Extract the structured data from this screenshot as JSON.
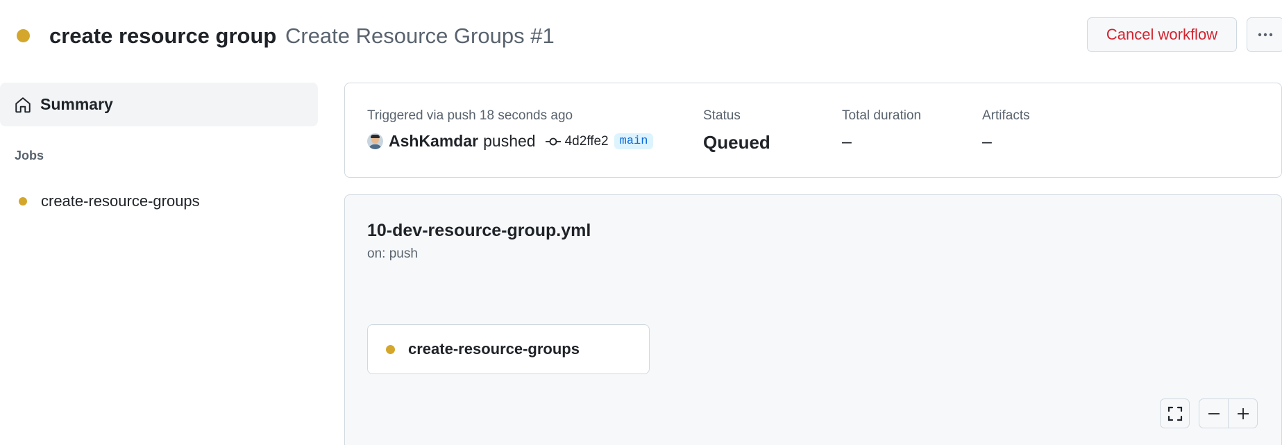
{
  "header": {
    "status_color": "#d4a72c",
    "workflow_name": "create resource group",
    "run_title": "Create Resource Groups #1",
    "cancel_label": "Cancel workflow",
    "more_label": "···"
  },
  "sidebar": {
    "summary_label": "Summary",
    "summary_icon": "home-icon",
    "jobs_heading": "Jobs",
    "jobs": [
      {
        "label": "create-resource-groups",
        "status": "queued"
      }
    ]
  },
  "info": {
    "trigger_label": "Triggered via push 18 seconds ago",
    "actor": "AshKamdar",
    "action": "pushed",
    "commit_sha": "4d2ffe2",
    "branch": "main",
    "status_label": "Status",
    "status_value": "Queued",
    "duration_label": "Total duration",
    "duration_value": "–",
    "artifacts_label": "Artifacts",
    "artifacts_value": "–"
  },
  "graph": {
    "file_name": "10-dev-resource-group.yml",
    "trigger": "on: push",
    "job_card_label": "create-resource-groups",
    "controls": [
      "fullscreen-icon",
      "zoom-out-icon",
      "zoom-in-icon"
    ]
  },
  "colors": {
    "queued": "#d4a72c",
    "danger": "#d1242f",
    "link": "#0969da"
  }
}
